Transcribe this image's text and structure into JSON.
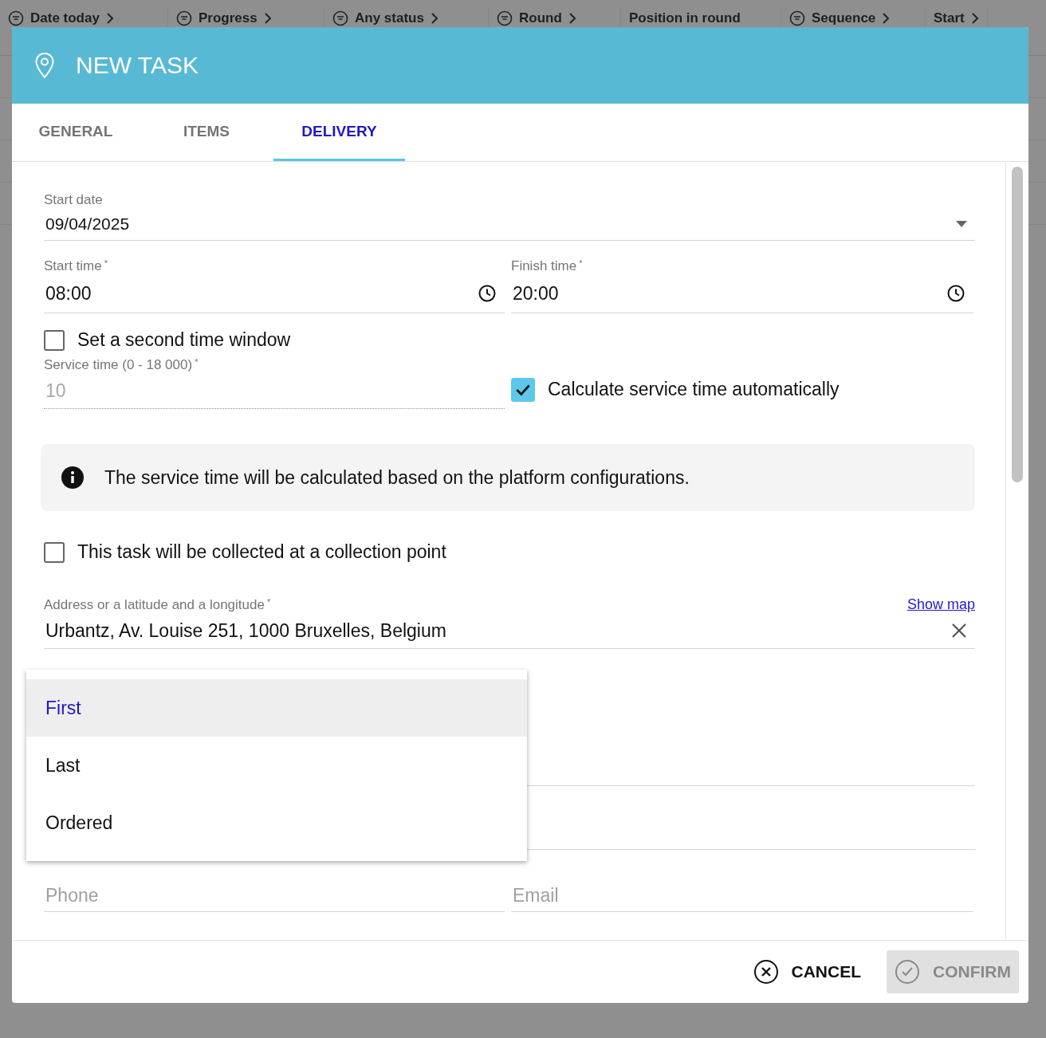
{
  "background_table": {
    "columns": [
      {
        "label": "Date today",
        "filter_icon": true,
        "chevron": true
      },
      {
        "label": "Progress",
        "filter_icon": true,
        "chevron": true
      },
      {
        "label": "Any status",
        "filter_icon": true,
        "chevron": true
      },
      {
        "label": "Round",
        "filter_icon": true,
        "chevron": true
      },
      {
        "label": "Position in round",
        "filter_icon": false,
        "chevron": false
      },
      {
        "label": "Sequence",
        "filter_icon": true,
        "chevron": true
      },
      {
        "label": "Start",
        "filter_icon": false,
        "chevron": true
      }
    ]
  },
  "dialog": {
    "title": "NEW TASK",
    "tabs": [
      {
        "label": "GENERAL",
        "selected": false
      },
      {
        "label": "ITEMS",
        "selected": false
      },
      {
        "label": "DELIVERY",
        "selected": true
      }
    ],
    "start_date": {
      "label": "Start date",
      "value": "09/04/2025"
    },
    "start_time": {
      "label": "Start time",
      "required_mark": "*",
      "value": "08:00"
    },
    "finish_time": {
      "label": "Finish time",
      "required_mark": "*",
      "value": "20:00"
    },
    "second_window": {
      "label": "Set a second time window",
      "checked": false
    },
    "service_time": {
      "label": "Service time (0 - 18 000)",
      "required_mark": "*",
      "value": "10",
      "disabled": true
    },
    "auto_service": {
      "label": "Calculate service time automatically",
      "checked": true
    },
    "info": "The service time will be calculated based on the platform configurations.",
    "collection_point": {
      "label": "This task will be collected at a collection point",
      "checked": false
    },
    "address": {
      "label": "Address or a latitude and a longitude",
      "required_mark": "*",
      "value": "Urbantz, Av. Louise 251, 1000 Bruxelles, Belgium",
      "link": "Show map"
    },
    "dropdown": [
      {
        "label": "First",
        "selected": true
      },
      {
        "label": "Last",
        "selected": false
      },
      {
        "label": "Ordered",
        "selected": false
      }
    ],
    "phone": {
      "placeholder": "Phone"
    },
    "email": {
      "placeholder": "Email"
    },
    "buttons": [
      {
        "kind": "cancel",
        "label": "CANCEL",
        "disabled": false
      },
      {
        "kind": "confirm",
        "label": "CONFIRM",
        "disabled": true
      }
    ]
  }
}
